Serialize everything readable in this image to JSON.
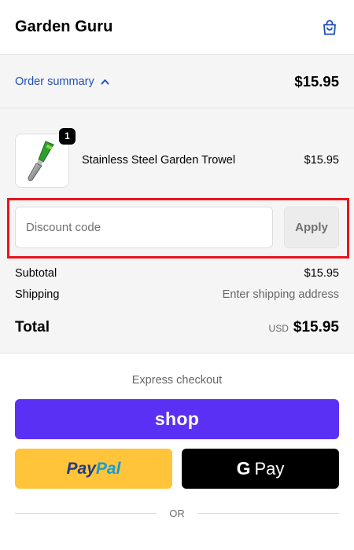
{
  "header": {
    "store_name": "Garden Guru",
    "cart_icon": "shopping-bag-icon"
  },
  "summary": {
    "toggle_label": "Order summary",
    "toggle_icon": "chevron-up-icon",
    "total": "$15.95"
  },
  "line_items": [
    {
      "name": "Stainless Steel Garden Trowel",
      "quantity": "1",
      "price": "$15.95"
    }
  ],
  "discount": {
    "placeholder": "Discount code",
    "value": "",
    "apply_label": "Apply"
  },
  "totals": {
    "subtotal_label": "Subtotal",
    "subtotal_value": "$15.95",
    "shipping_label": "Shipping",
    "shipping_value": "Enter shipping address",
    "total_label": "Total",
    "currency": "USD",
    "total_value": "$15.95"
  },
  "express": {
    "title": "Express checkout",
    "shop_label": "shop",
    "paypal_pay": "Pay",
    "paypal_pal": "Pal",
    "gpay_g": "G",
    "gpay_label": "Pay",
    "or_label": "OR"
  },
  "colors": {
    "link_blue": "#1f4fb5",
    "shop_purple": "#5a31f4",
    "paypal_yellow": "#ffc439",
    "highlight_red": "#e8141c"
  }
}
